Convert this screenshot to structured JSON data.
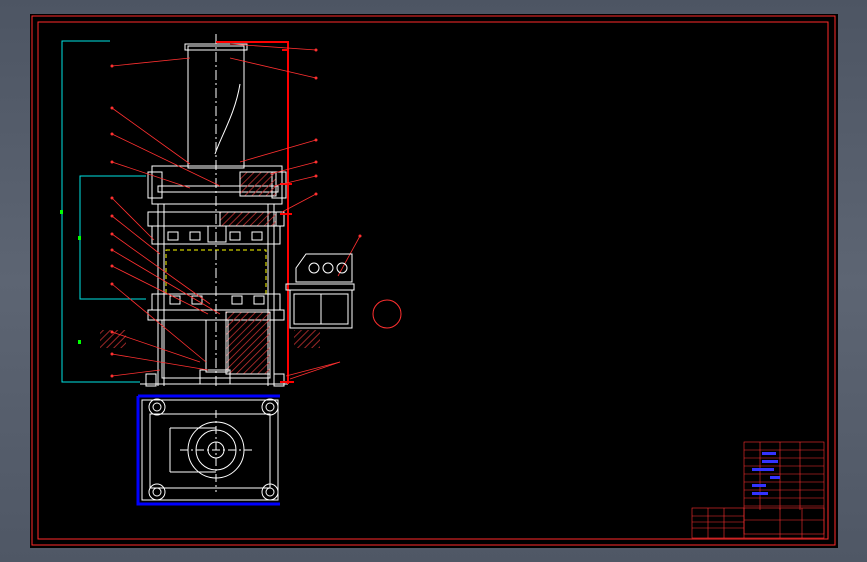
{
  "drawing": {
    "background": "#000000",
    "frame_color": "#ff0000",
    "line_color": "#ffffff",
    "accent_colors": {
      "red": "#ff0000",
      "cyan": "#00ffff",
      "green": "#00ff00",
      "blue": "#0000ff",
      "hatch": "#cc3333"
    },
    "views": [
      "front-elevation",
      "top-plan",
      "control-cabinet",
      "title-block",
      "parts-list"
    ]
  }
}
